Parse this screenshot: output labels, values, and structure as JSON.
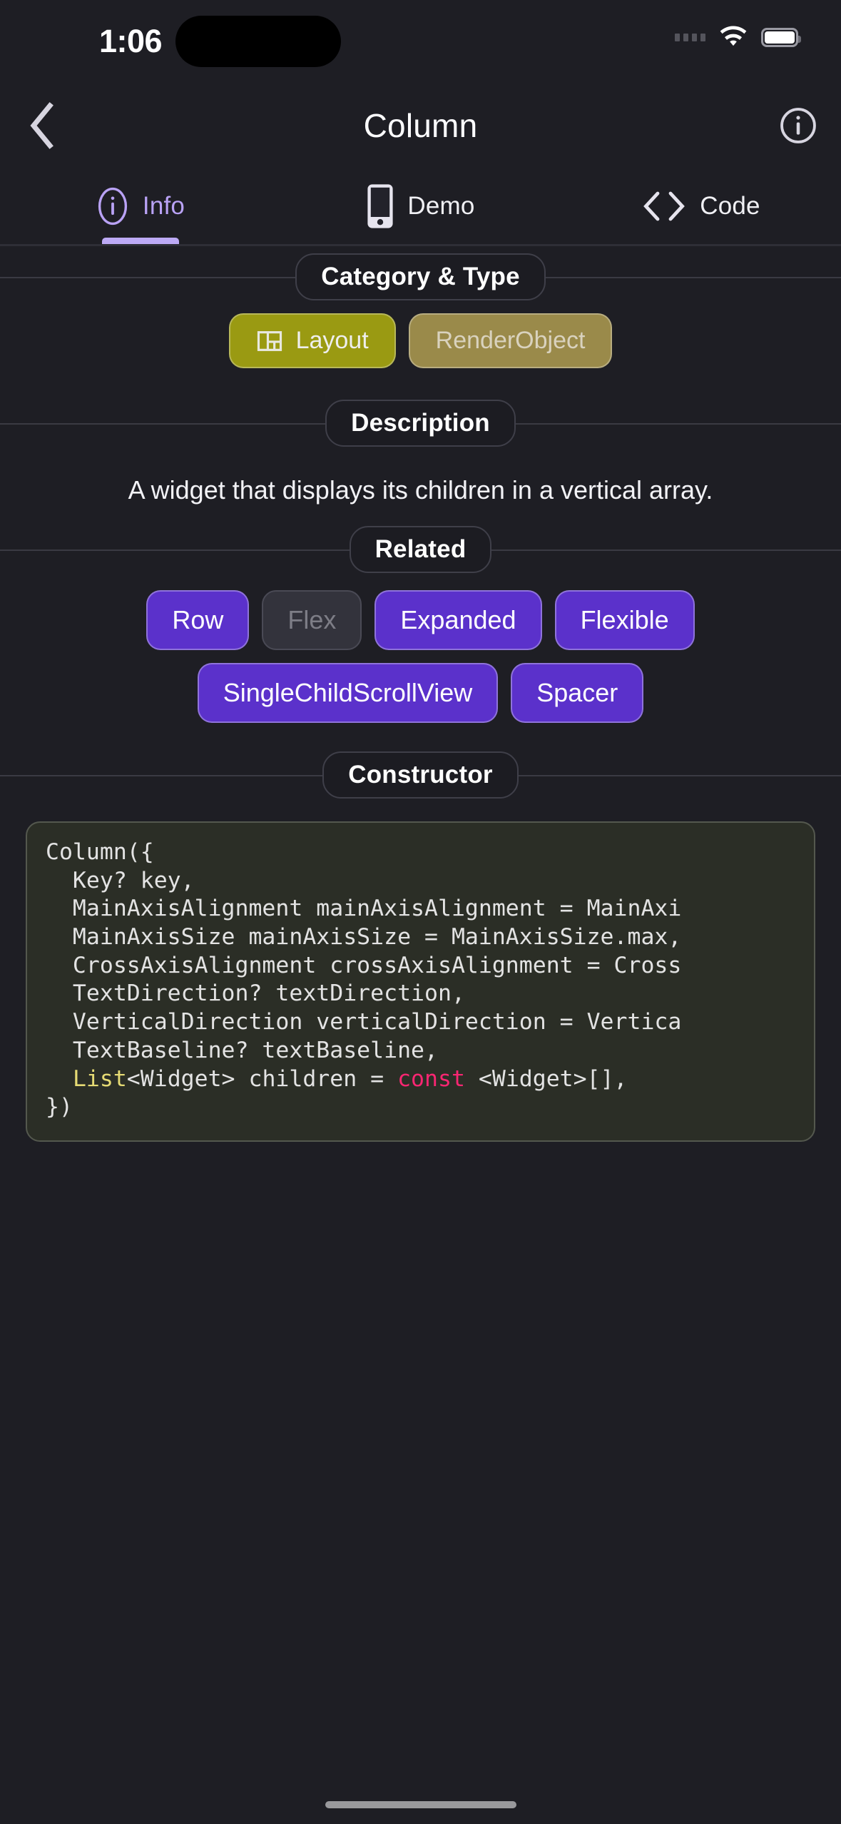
{
  "status_bar": {
    "time": "1:06",
    "icons": [
      "cellular-signal-icon",
      "wifi-icon",
      "battery-icon"
    ]
  },
  "nav": {
    "back_icon": "chevron-left-icon",
    "title": "Column",
    "info_icon": "info-circle-icon"
  },
  "tabs": [
    {
      "label": "Info",
      "icon": "info-circle-icon",
      "active": true
    },
    {
      "label": "Demo",
      "icon": "mobile-phone-icon",
      "active": false
    },
    {
      "label": "Code",
      "icon": "angle-brackets-icon",
      "active": false
    }
  ],
  "sections": {
    "category_type": {
      "title": "Category & Type",
      "chips": [
        {
          "label": "Layout",
          "icon": "dashboard-layout-icon",
          "color": "#9a9a12",
          "muted": false
        },
        {
          "label": "RenderObject",
          "icon": "",
          "color": "#9a8a4a",
          "muted": true
        }
      ]
    },
    "description": {
      "title": "Description",
      "text": "A widget that displays its children in a vertical array."
    },
    "related": {
      "title": "Related",
      "chips": [
        {
          "label": "Row",
          "muted": false
        },
        {
          "label": "Flex",
          "muted": true
        },
        {
          "label": "Expanded",
          "muted": false
        },
        {
          "label": "Flexible",
          "muted": false
        },
        {
          "label": "SingleChildScrollView",
          "muted": false
        },
        {
          "label": "Spacer",
          "muted": false
        }
      ]
    },
    "constructor": {
      "title": "Constructor",
      "lines": [
        "Column({",
        "  Key? key,",
        "  MainAxisAlignment mainAxisAlignment = MainAxi",
        "  MainAxisSize mainAxisSize = MainAxisSize.max,",
        "  CrossAxisAlignment crossAxisAlignment = Cross",
        "  TextDirection? textDirection,",
        "  VerticalDirection verticalDirection = Vertica",
        "  TextBaseline? textBaseline,",
        "  List<Widget> children = const <Widget>[],",
        "})"
      ]
    }
  },
  "colors": {
    "background": "#1e1e24",
    "accent_purple": "#5b31cb",
    "tab_active": "#b9a2f5",
    "chip_layout": "#9a9a12",
    "chip_render": "#9a8a4a",
    "code_bg": "#2b2e26",
    "code_keyword": "#f92672",
    "code_type": "#e6db74"
  }
}
